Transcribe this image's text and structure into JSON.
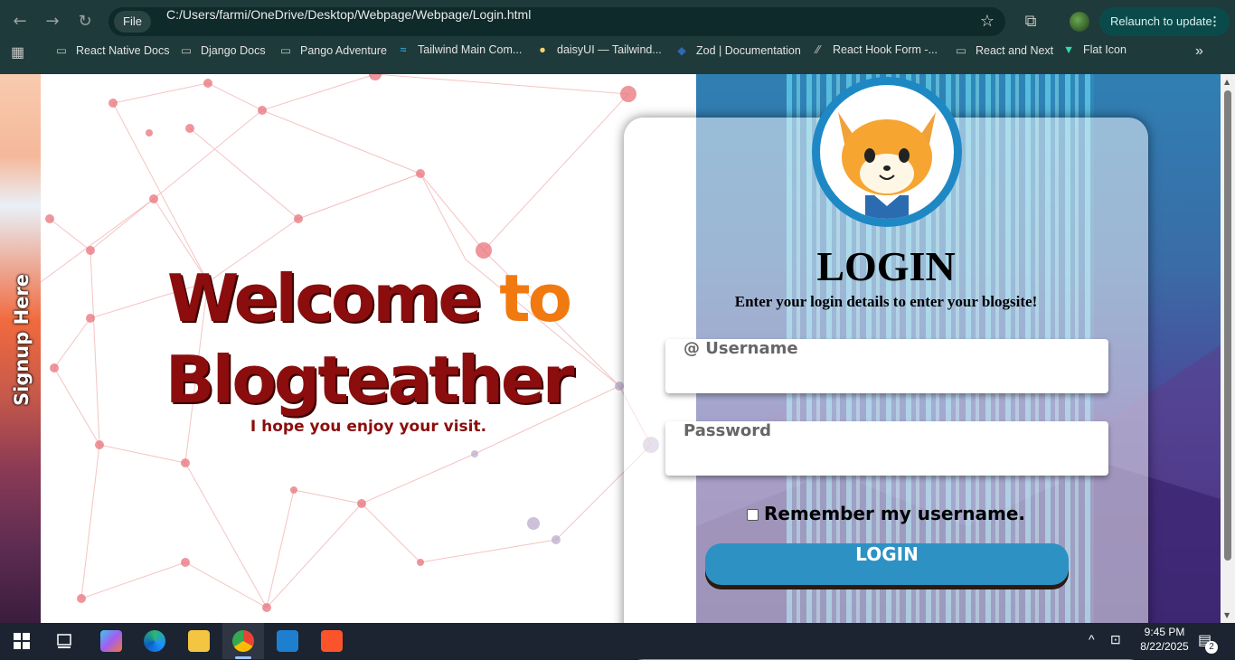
{
  "browser": {
    "file_chip": "File",
    "url": "C:/Users/farmi/OneDrive/Desktop/Webpage/Webpage/Login.html",
    "relaunch_label": "Relaunch to update",
    "bookmarks": [
      {
        "label": "React Native Docs",
        "icon": "folder-icon"
      },
      {
        "label": "Django Docs",
        "icon": "folder-icon"
      },
      {
        "label": "Pango Adventure",
        "icon": "folder-icon"
      },
      {
        "label": "Tailwind Main Com...",
        "icon": "tailwind-icon"
      },
      {
        "label": "daisyUI — Tailwind...",
        "icon": "daisyui-icon"
      },
      {
        "label": "Zod | Documentation",
        "icon": "zod-icon"
      },
      {
        "label": "React Hook Form -...",
        "icon": "react-hook-form-icon"
      },
      {
        "label": "React and Next",
        "icon": "folder-icon"
      },
      {
        "label": "Flat Icon",
        "icon": "flaticon-icon"
      }
    ]
  },
  "page": {
    "signup_label": "Signup Here",
    "welcome_line1_a": "Welcome ",
    "welcome_line1_b": "to",
    "welcome_line2": "Blogteather",
    "subtitle": "I hope you enjoy your visit.",
    "login_title": "LOGIN",
    "login_subtitle": "Enter your login details to enter your blogsite!",
    "username_placeholder": "@ Username",
    "password_placeholder": "Password",
    "remember_label": "Remember my username.",
    "login_button": "LOGIN"
  },
  "taskbar": {
    "time": "9:45 PM",
    "date": "8/22/2025",
    "notification_count": "2"
  },
  "colors": {
    "welcome_dark": "#8b0d0d",
    "welcome_orange": "#f07a10",
    "login_button": "#2d91c4",
    "avatar_ring": "#1e88c4"
  }
}
